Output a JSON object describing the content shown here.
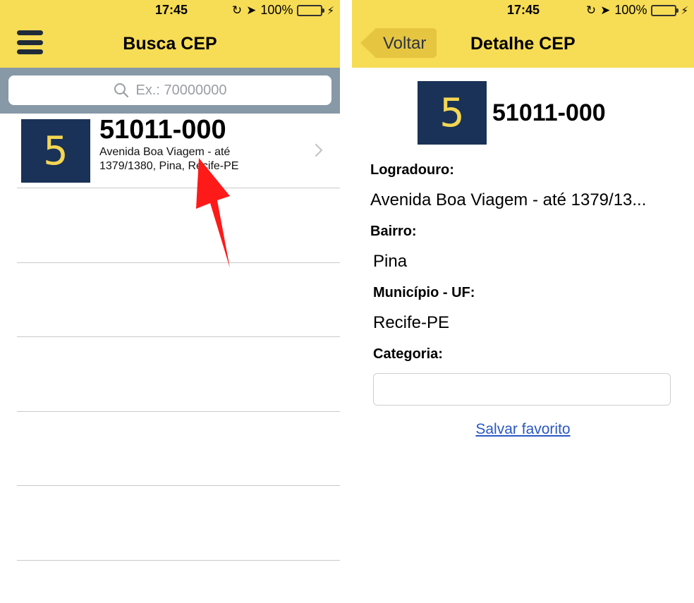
{
  "status_bar": {
    "time": "17:45",
    "battery_percent": "100%",
    "battery_level": 1.0
  },
  "colors": {
    "accent_yellow": "#f7dc55",
    "tile_navy": "#1a3257",
    "tile_digit": "#f3d653",
    "search_band": "#8798a7",
    "link_blue": "#2a57c4",
    "annotation_red": "#ff1a1a"
  },
  "list_screen": {
    "title": "Busca CEP",
    "search_placeholder": "Ex.: 70000000",
    "results": [
      {
        "tile_digit": "5",
        "cep": "51011-000",
        "address": "Avenida Boa Viagem - até 1379/1380, Pina, Recife-PE"
      }
    ]
  },
  "detail_screen": {
    "back_label": "Voltar",
    "title": "Detalhe CEP",
    "tile_digit": "5",
    "cep": "51011-000",
    "logradouro_label": "Logradouro:",
    "logradouro_value": "Avenida Boa Viagem - até 1379/13...",
    "bairro_label": "Bairro:",
    "bairro_value": "Pina",
    "municipio_label": "Município - UF:",
    "municipio_value": "Recife-PE",
    "categoria_label": "Categoria:",
    "categoria_value": "",
    "save_favorite_label": "Salvar favorito"
  }
}
